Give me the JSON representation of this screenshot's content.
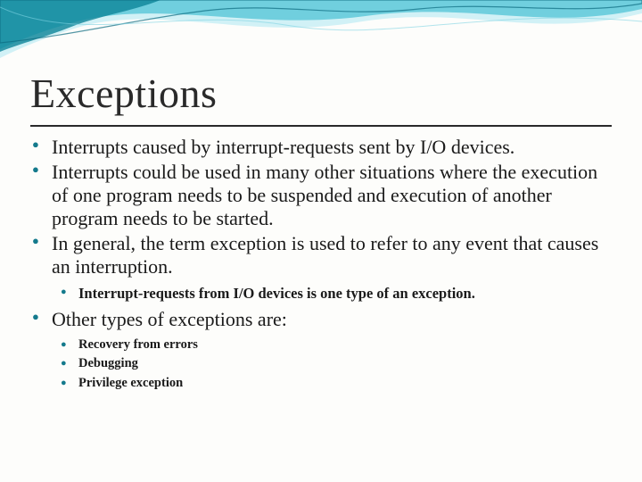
{
  "title": "Exceptions",
  "bullets": {
    "b1": "Interrupts caused by interrupt-requests sent by I/O devices.",
    "b2": "Interrupts could be used in many other situations where the execution of one program needs to be suspended and execution of another program needs to be started.",
    "b3": "In general, the term exception is used to refer to any event that causes an interruption.",
    "b3_sub1": "Interrupt-requests from I/O devices is one type of an exception.",
    "b4": "Other types of exceptions are:",
    "b4_sub1": "Recovery from errors",
    "b4_sub2": "Debugging",
    "b4_sub3": "Privilege exception"
  },
  "colors": {
    "accent": "#147a8c",
    "wave_light": "#8fd9e6",
    "wave_mid": "#3db5c9",
    "wave_dark": "#0d6b80"
  }
}
